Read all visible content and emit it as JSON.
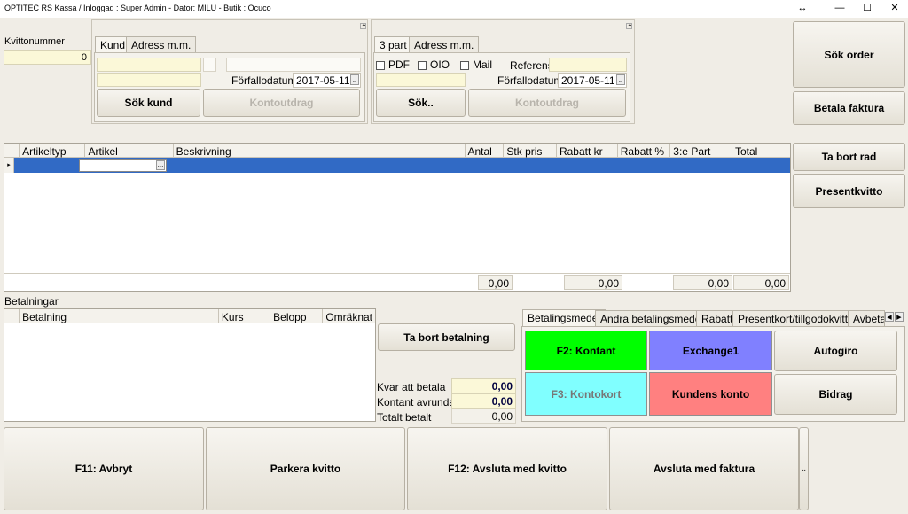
{
  "window": {
    "title": "OPTITEC RS Kassa / Inloggad : Super Admin - Dator: MILU -  Butik : Ocuco",
    "resize_icon": "↔",
    "minimize_icon": "—",
    "maximize_icon": "☐",
    "close_icon": "✕"
  },
  "receipt": {
    "label": "Kvittonummer",
    "value": "0"
  },
  "customer": {
    "tabs": [
      "Kund",
      "Adress m.m."
    ],
    "due_label": "Förfallodatum",
    "due_date": "2017-05-11",
    "search_button": "Sök kund",
    "statement_button": "Kontoutdrag"
  },
  "third_party": {
    "tabs": [
      "3 part",
      "Adress m.m."
    ],
    "pdf_label": "PDF",
    "oio_label": "OIO",
    "mail_label": "Mail",
    "reference_label": "Referens",
    "due_label": "Förfallodatum",
    "due_date": "2017-05-11",
    "search_button": "Sök..",
    "statement_button": "Kontoutdrag"
  },
  "right_buttons": {
    "search_order": "Sök order",
    "pay_invoice": "Betala faktura",
    "remove_row": "Ta bort rad",
    "gift_receipt": "Presentkvitto"
  },
  "articles": {
    "columns": [
      "Artikeltyp",
      "Artikel",
      "Beskrivning",
      "Antal",
      "Stk pris",
      "Rabatt kr",
      "Rabatt %",
      "3:e Part",
      "Total"
    ],
    "ellipsis": "...",
    "totals": [
      "0,00",
      "0,00",
      "0,00",
      "0,00"
    ]
  },
  "payments": {
    "label": "Betalningar",
    "columns": [
      "Betalning",
      "Kurs",
      "Belopp",
      "Omräknat"
    ],
    "remove_button": "Ta bort betalning",
    "remaining_label": "Kvar att betala",
    "remaining_value": "0,00",
    "cash_rounded_label": "Kontant avrundat",
    "cash_rounded_value": "0,00",
    "total_paid_label": "Totalt betalt",
    "total_paid_value": "0,00"
  },
  "pay_tabs": [
    "Betalingsmedel",
    "Andra betalingsmedel",
    "Rabatt",
    "Presentkort/tillgodokvitto",
    "Avbetal"
  ],
  "pay_methods": {
    "cash": "F2: Kontant",
    "exchange": "Exchange1",
    "autogiro": "Autogiro",
    "card": "F3: Kontokort",
    "customer_account": "Kundens konto",
    "bidrag": "Bidrag"
  },
  "bottom_buttons": {
    "cancel": "F11: Avbryt",
    "park": "Parkera kvitto",
    "finish_receipt": "F12: Avsluta med kvitto",
    "finish_invoice": "Avsluta med faktura"
  },
  "colors": {
    "cash": "#00ff00",
    "exchange": "#8080ff",
    "card": "#80ffff",
    "customer_account": "#ff8080",
    "selection": "#316ac5"
  }
}
